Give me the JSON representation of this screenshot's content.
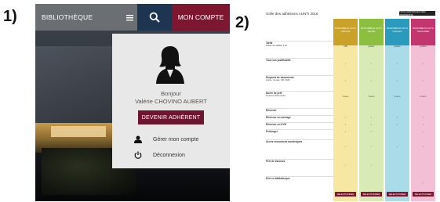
{
  "step_labels": [
    "1)",
    "2)"
  ],
  "mobile": {
    "topbar": {
      "bibliotheque_label": "BIBLIOTHÈQUE",
      "menu_icon": "hamburger-icon",
      "search_icon": "search-icon",
      "account_label": "MON COMPTE"
    },
    "colors": {
      "topbar_grey": "#6b6f74",
      "search_navy": "#1d3550",
      "account_burgundy": "#7d1730",
      "member_button": "#6e1630"
    },
    "account_menu": {
      "avatar_icon": "user-silhouette-icon",
      "greeting": "Bonjour",
      "user_name": "Valérie CHOVINO AUBERT",
      "become_member_button": "DEVENIR ADHÉRENT",
      "manage_account_icon": "person-icon",
      "manage_account_label": "Gérer mon compte",
      "logout_icon": "power-icon",
      "logout_label": "Déconnexion"
    }
  },
  "document": {
    "title": "Grille des adhésions AUNTI 2016",
    "top_button": "TOUS AVANTAGES DES ADHÉSIONS",
    "columns": [
      {
        "header": "PASS BIBLIO ACTU\nADULTE",
        "color": "#c9a227",
        "tint": "#f6e7a3"
      },
      {
        "header": "PASS BIBLIO ACTU\nJEUNE",
        "color": "#8cbf3f",
        "tint": "#d8ebb6"
      },
      {
        "header": "PASS BIBLIO ACTU\nCOLLEC",
        "color": "#2a9bbd",
        "tint": "#a9dbe9"
      },
      {
        "header": "PASS BIBLIO ACTU\nSCOLAIRE",
        "color": "#c2356f",
        "tint": "#f2bfd4"
      }
    ],
    "rows": [
      {
        "label": "Tarifs",
        "sub": "Durée de validité 1 an",
        "cells": [
          "15€",
          "gratuit",
          "gratuit",
          "gratuit"
        ]
      },
      {
        "label": "Tous vos justificatifs",
        "sub": "",
        "cells": [
          "✓",
          "✓",
          "✓",
          "✓"
        ]
      },
      {
        "label": "Emprunt de documents",
        "sub": "Livres, revues, CD, DVD",
        "cells": [
          "✓",
          "✓",
          "✓",
          "✓"
        ]
      },
      {
        "label": "Durée de prêt",
        "sub": "Tous les documents",
        "cells": [
          "4 sem",
          "4 sem",
          "6 sem",
          "8 sem"
        ]
      },
      {
        "label": "Réserver",
        "sub": "",
        "cells": [
          "",
          "",
          "",
          ""
        ]
      },
      {
        "label": "Réserver un ouvrage",
        "sub": "",
        "cells": [
          "✓",
          "✓",
          "✓",
          "✓"
        ]
      },
      {
        "label": "Réserver un DVD",
        "sub": "",
        "cells": [
          "✓",
          "✓",
          "✓",
          "✓"
        ]
      },
      {
        "label": "Prolonger",
        "sub": "",
        "cells": [
          "✓",
          "✓",
          "",
          "✓"
        ]
      },
      {
        "label": "Accès ressources numériques",
        "sub": "",
        "cells": [
          "✓",
          "✓",
          "✓",
          "✓"
        ]
      },
      {
        "label": "Prêt de liseuses",
        "sub": "",
        "cells": [
          "✓",
          "✓",
          "",
          ""
        ]
      },
      {
        "label": "Prêt en bibliothèque",
        "sub": "",
        "cells": [
          "",
          "",
          "",
          "✓"
        ]
      }
    ],
    "select_button": "SÉLECTIONNER"
  }
}
